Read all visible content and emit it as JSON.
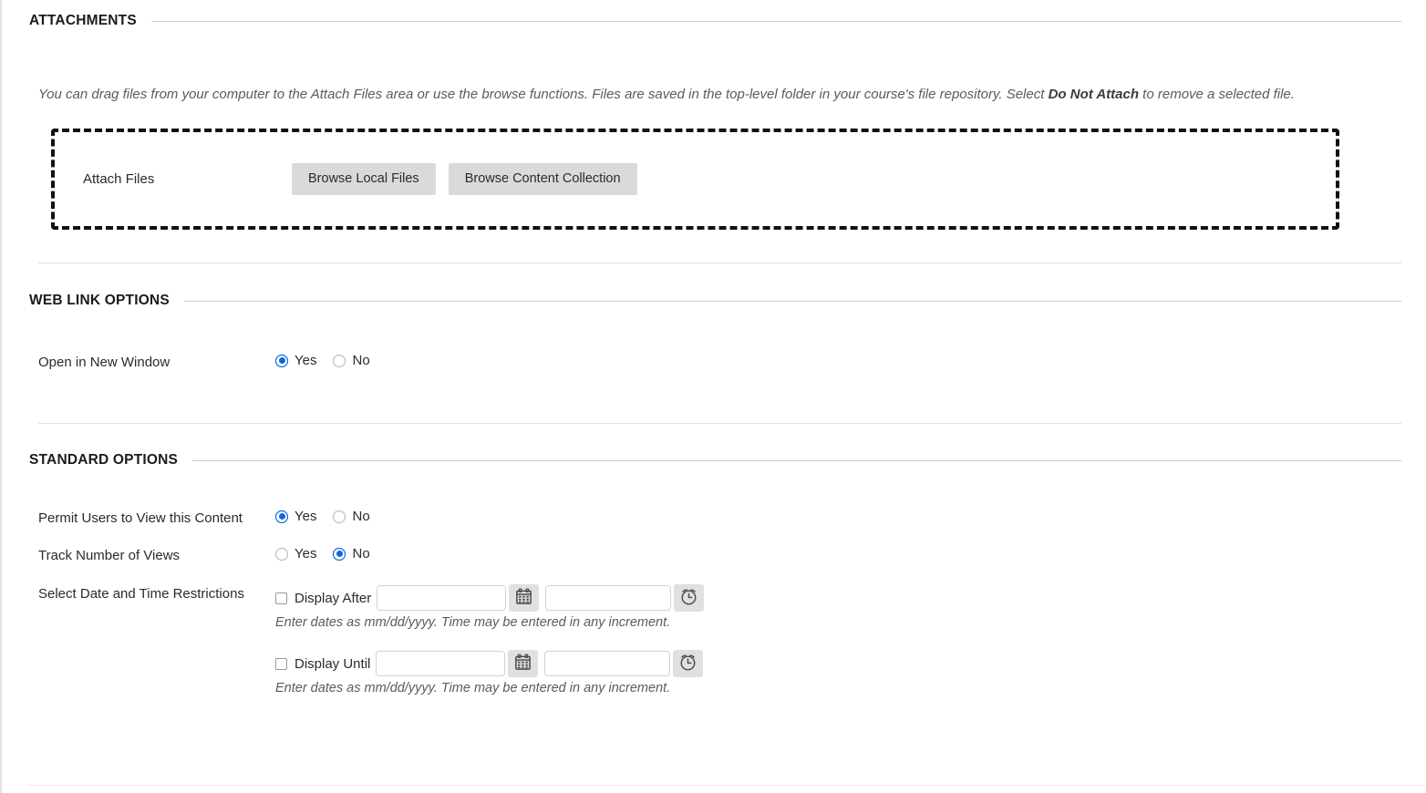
{
  "sections": {
    "attachments": {
      "title": "ATTACHMENTS",
      "help_prefix": "You can drag files from your computer to the Attach Files area or use the browse functions. Files are saved in the top-level folder in your course's file repository.  Select ",
      "help_bold": "Do Not Attach",
      "help_suffix": " to remove a selected file.",
      "attach_label": "Attach Files",
      "browse_local_label": "Browse Local Files",
      "browse_content_label": "Browse Content Collection"
    },
    "web_link_options": {
      "title": "WEB LINK OPTIONS",
      "open_new_window": {
        "label": "Open in New Window",
        "yes_label": "Yes",
        "no_label": "No",
        "selected": "Yes"
      }
    },
    "standard_options": {
      "title": "STANDARD OPTIONS",
      "permit_users": {
        "label": "Permit Users to View this Content",
        "yes_label": "Yes",
        "no_label": "No",
        "selected": "Yes"
      },
      "track_views": {
        "label": "Track Number of Views",
        "yes_label": "Yes",
        "no_label": "No",
        "selected": "No"
      },
      "date_restrictions": {
        "label": "Select Date and Time Restrictions",
        "display_after": {
          "checkbox_label": "Display After",
          "checked": false,
          "date_value": "",
          "time_value": "",
          "hint": "Enter dates as mm/dd/yyyy. Time may be entered in any increment."
        },
        "display_until": {
          "checkbox_label": "Display Until",
          "checked": false,
          "date_value": "",
          "time_value": "",
          "hint": "Enter dates as mm/dd/yyyy. Time may be entered in any increment."
        }
      }
    }
  },
  "icons": {
    "calendar": "calendar-icon",
    "clock": "clock-icon"
  },
  "colors": {
    "accent": "#0a68e0",
    "button_bg": "#dadada",
    "rule": "#cccccc",
    "text": "#2b2b2b"
  }
}
